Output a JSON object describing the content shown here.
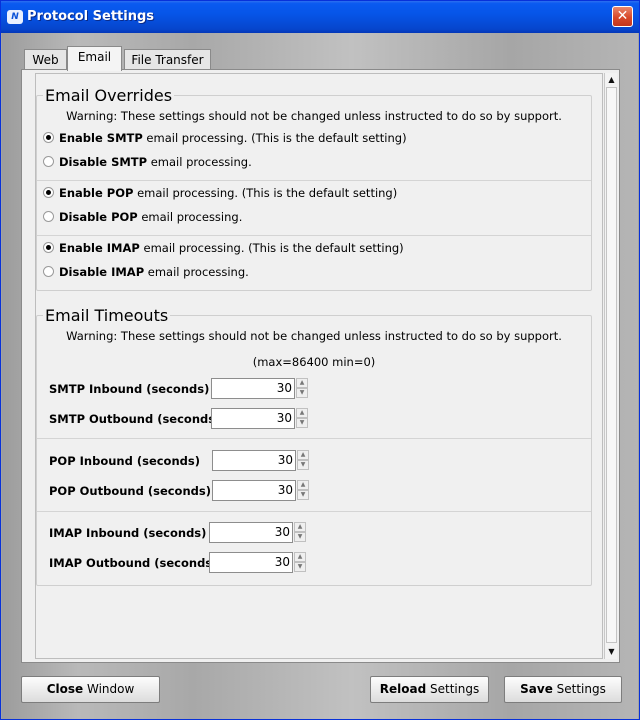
{
  "window": {
    "title": "Protocol Settings",
    "app_icon_text": "N",
    "close_glyph": "✕"
  },
  "tabs": [
    {
      "label": "Web",
      "active": false
    },
    {
      "label": "Email",
      "active": true
    },
    {
      "label": "File Transfer",
      "active": false
    }
  ],
  "email_overrides": {
    "title": "Email Overrides",
    "warning": "Warning:  These settings should not be changed unless instructed to do so by support.",
    "protocols": [
      {
        "enable": {
          "bold": "Enable SMTP",
          "rest": " email processing. (This is the default setting)",
          "checked": true
        },
        "disable": {
          "bold": "Disable SMTP",
          "rest": " email processing.",
          "checked": false
        }
      },
      {
        "enable": {
          "bold": "Enable POP",
          "rest": " email processing. (This is the default setting)",
          "checked": true
        },
        "disable": {
          "bold": "Disable POP",
          "rest": " email processing.",
          "checked": false
        }
      },
      {
        "enable": {
          "bold": "Enable IMAP",
          "rest": " email processing. (This is the default setting)",
          "checked": true
        },
        "disable": {
          "bold": "Disable IMAP",
          "rest": " email processing.",
          "checked": false
        }
      }
    ]
  },
  "email_timeouts": {
    "title": "Email Timeouts",
    "warning": "Warning:  These settings should not be changed unless instructed to do so by support.",
    "range_note": "(max=86400 min=0)",
    "fields": [
      {
        "label": "SMTP Inbound (seconds)",
        "value": "30"
      },
      {
        "label": "SMTP Outbound (seconds)",
        "value": "30"
      },
      {
        "label": "POP Inbound (seconds)",
        "value": "30"
      },
      {
        "label": "POP Outbound (seconds)",
        "value": "30"
      },
      {
        "label": "IMAP Inbound (seconds)",
        "value": "30"
      },
      {
        "label": "IMAP Outbound (seconds)",
        "value": "30"
      }
    ]
  },
  "buttons": {
    "close": {
      "bold": "Close",
      "rest": " Window"
    },
    "reload": {
      "bold": "Reload",
      "rest": " Settings"
    },
    "save": {
      "bold": "Save",
      "rest": " Settings"
    }
  },
  "icons": {
    "scroll_up": "▲",
    "scroll_down": "▼",
    "spin_up": "▲",
    "spin_down": "▼"
  },
  "colors": {
    "titlebar": "#0655e8",
    "close_button": "#d8482a"
  }
}
